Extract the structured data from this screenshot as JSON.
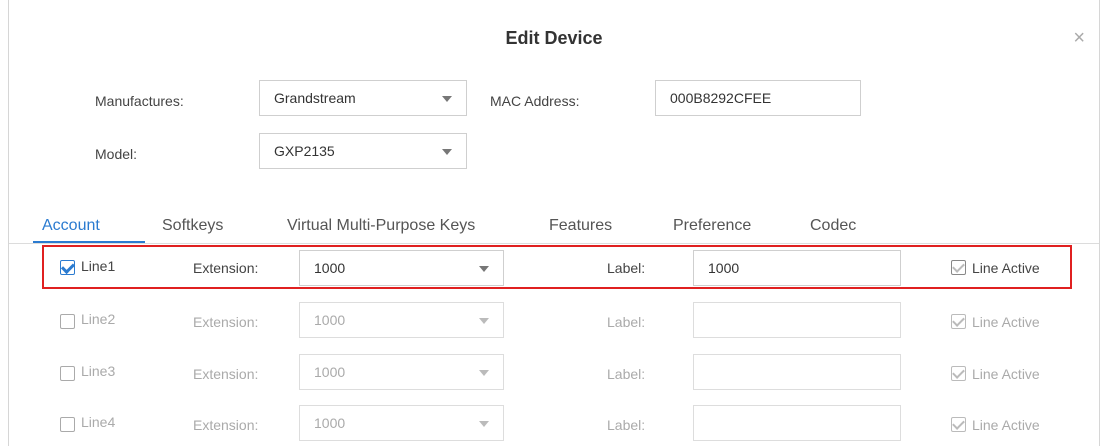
{
  "dialog": {
    "title": "Edit Device",
    "close_glyph": "×",
    "manufacturer_label": "Manufactures:",
    "manufacturer_value": "Grandstream",
    "mac_label": "MAC Address:",
    "mac_value": "000B8292CFEE",
    "model_label": "Model:",
    "model_value": "GXP2135"
  },
  "tabs": [
    {
      "label": "Account",
      "active": true
    },
    {
      "label": "Softkeys",
      "active": false
    },
    {
      "label": "Virtual Multi-Purpose Keys",
      "active": false
    },
    {
      "label": "Features",
      "active": false
    },
    {
      "label": "Preference",
      "active": false
    },
    {
      "label": "Codec",
      "active": false
    }
  ],
  "lines": [
    {
      "name": "Line1",
      "checked": true,
      "extension_label": "Extension:",
      "extension_value": "1000",
      "label_label": "Label:",
      "label_value": "1000",
      "line_active_label": "Line Active",
      "line_active": true,
      "enabled": true
    },
    {
      "name": "Line2",
      "checked": false,
      "extension_label": "Extension:",
      "extension_value": "1000",
      "label_label": "Label:",
      "label_value": "",
      "line_active_label": "Line Active",
      "line_active": true,
      "enabled": false
    },
    {
      "name": "Line3",
      "checked": false,
      "extension_label": "Extension:",
      "extension_value": "1000",
      "label_label": "Label:",
      "label_value": "",
      "line_active_label": "Line Active",
      "line_active": true,
      "enabled": false
    },
    {
      "name": "Line4",
      "checked": false,
      "extension_label": "Extension:",
      "extension_value": "1000",
      "label_label": "Label:",
      "label_value": "",
      "line_active_label": "Line Active",
      "line_active": true,
      "enabled": false
    }
  ],
  "colors": {
    "accent": "#2b7bd0",
    "highlight": "#e02020"
  }
}
